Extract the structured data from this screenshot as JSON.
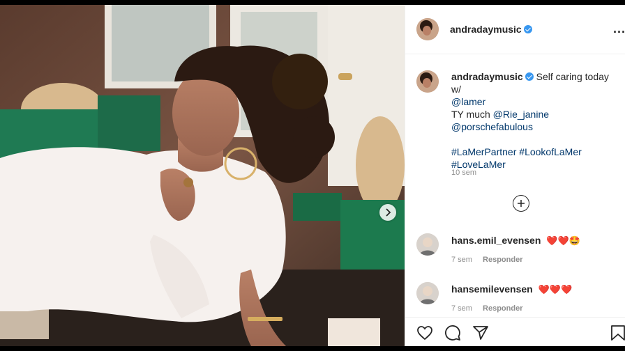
{
  "post": {
    "author": "andradaymusic",
    "caption_lines": [
      "Self caring today w/"
    ],
    "mentions": [
      "@lamer",
      "@Rie_janine",
      "@porschefabulous"
    ],
    "thanks": "TY much",
    "hashtags": [
      "#LaMerPartner",
      "#LookofLaMer",
      "#LoveLaMer"
    ],
    "time": "10 sem"
  },
  "header": {
    "more": "..."
  },
  "comments": [
    {
      "user": "hans.emil_evensen",
      "emoji": "❤️❤️🤩",
      "time": "7 sem",
      "reply": "Responder"
    },
    {
      "user": "hansemilevensen",
      "emoji": "❤️❤️❤️",
      "time": "7 sem",
      "reply": "Responder"
    }
  ],
  "icons": {
    "next": "chevron-right-icon",
    "load_more": "plus-circle-icon",
    "like": "heart-icon",
    "comment": "comment-icon",
    "share": "send-icon",
    "save": "bookmark-icon"
  },
  "colors": {
    "verified": "#3897f0",
    "link": "#00376b",
    "meta": "#8e8e8e",
    "heart": "#e0245e"
  }
}
